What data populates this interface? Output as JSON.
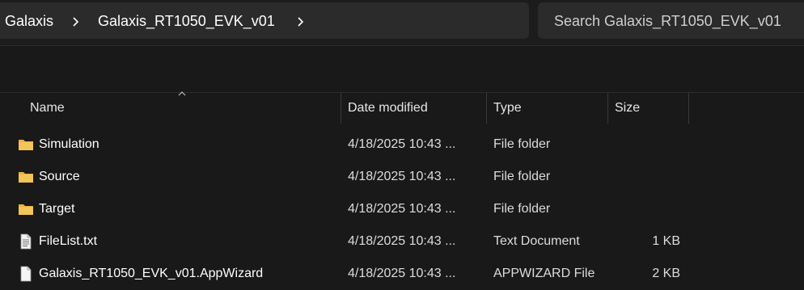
{
  "breadcrumb": {
    "items": [
      {
        "label": "Galaxis"
      },
      {
        "label": "Galaxis_RT1050_EVK_v01"
      }
    ]
  },
  "search": {
    "placeholder": "Search Galaxis_RT1050_EVK_v01"
  },
  "columns": {
    "name": "Name",
    "date": "Date modified",
    "type": "Type",
    "size": "Size"
  },
  "files": [
    {
      "name": "Simulation",
      "date": "4/18/2025 10:43 ...",
      "type": "File folder",
      "size": "",
      "icon": "folder-icon"
    },
    {
      "name": "Source",
      "date": "4/18/2025 10:43 ...",
      "type": "File folder",
      "size": "",
      "icon": "folder-icon"
    },
    {
      "name": "Target",
      "date": "4/18/2025 10:43 ...",
      "type": "File folder",
      "size": "",
      "icon": "folder-icon"
    },
    {
      "name": "FileList.txt",
      "date": "4/18/2025 10:43 ...",
      "type": "Text Document",
      "size": "1 KB",
      "icon": "text-file-icon"
    },
    {
      "name": "Galaxis_RT1050_EVK_v01.AppWizard",
      "date": "4/18/2025 10:43 ...",
      "type": "APPWIZARD File",
      "size": "2 KB",
      "icon": "file-icon"
    }
  ],
  "colors": {
    "background": "#191919",
    "bar": "#2b2b2b",
    "folder": "#f3c45a"
  }
}
